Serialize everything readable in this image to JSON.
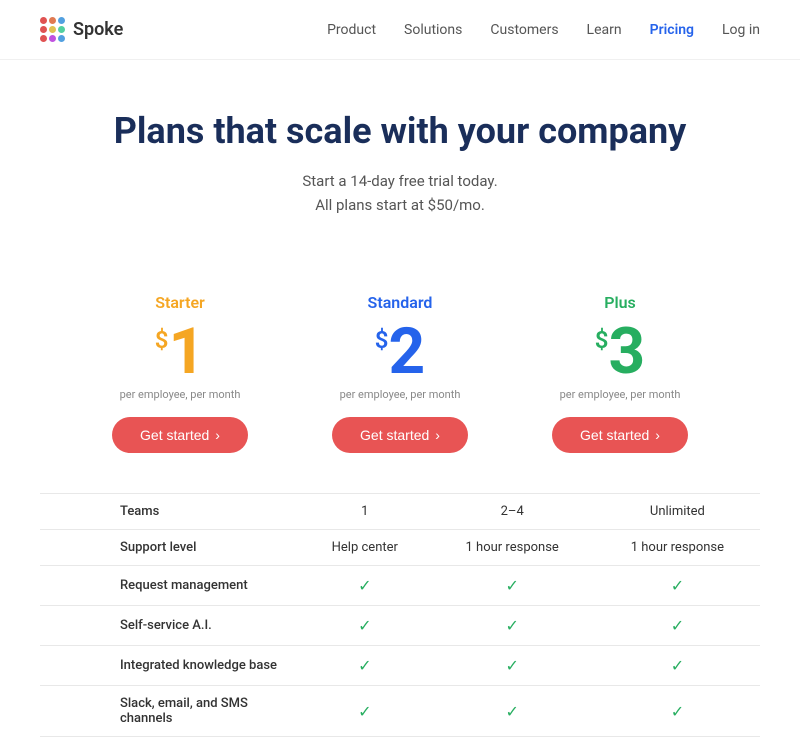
{
  "logo": {
    "name": "Spoke"
  },
  "nav": {
    "links": [
      {
        "label": "Product",
        "active": false
      },
      {
        "label": "Solutions",
        "active": false
      },
      {
        "label": "Customers",
        "active": false
      },
      {
        "label": "Learn",
        "active": false
      },
      {
        "label": "Pricing",
        "active": true
      },
      {
        "label": "Log in",
        "active": false
      }
    ]
  },
  "hero": {
    "title": "Plans that scale with your company",
    "subtitle_line1": "Start a 14-day free trial today.",
    "subtitle_line2": "All plans start at $50/mo."
  },
  "plans": [
    {
      "id": "starter",
      "name": "Starter",
      "color": "starter",
      "price_symbol": "$",
      "price": "1",
      "period": "per employee, per month",
      "btn_label": "Get started",
      "btn_arrow": "›"
    },
    {
      "id": "standard",
      "name": "Standard",
      "color": "standard",
      "price_symbol": "$",
      "price": "2",
      "period": "per employee, per month",
      "btn_label": "Get started",
      "btn_arrow": "›"
    },
    {
      "id": "plus",
      "name": "Plus",
      "color": "plus",
      "price_symbol": "$",
      "price": "3",
      "period": "per employee, per month",
      "btn_label": "Get started",
      "btn_arrow": "›"
    }
  ],
  "features": [
    {
      "label": "Teams",
      "starter": "1",
      "standard": "2–4",
      "plus": "Unlimited",
      "type": "text"
    },
    {
      "label": "Support level",
      "starter": "Help center",
      "standard": "1 hour response",
      "plus": "1 hour response",
      "type": "text"
    },
    {
      "label": "Request management",
      "starter": "✓",
      "standard": "✓",
      "plus": "✓",
      "type": "check"
    },
    {
      "label": "Self-service A.I.",
      "starter": "✓",
      "standard": "✓",
      "plus": "✓",
      "type": "check"
    },
    {
      "label": "Integrated knowledge base",
      "starter": "✓",
      "standard": "✓",
      "plus": "✓",
      "type": "check"
    },
    {
      "label": "Slack, email, and SMS channels",
      "starter": "✓",
      "standard": "✓",
      "plus": "✓",
      "type": "check"
    }
  ]
}
